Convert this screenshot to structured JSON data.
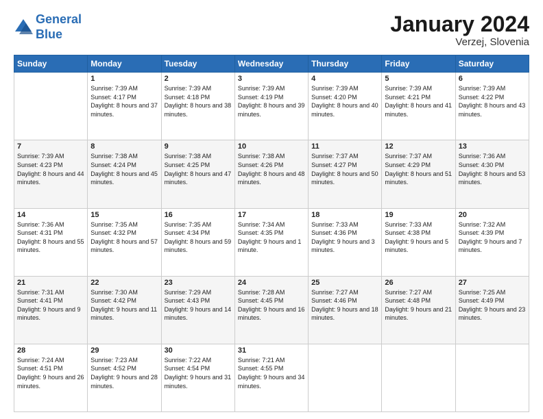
{
  "header": {
    "logo_line1": "General",
    "logo_line2": "Blue",
    "month_year": "January 2024",
    "location": "Verzej, Slovenia"
  },
  "weekdays": [
    "Sunday",
    "Monday",
    "Tuesday",
    "Wednesday",
    "Thursday",
    "Friday",
    "Saturday"
  ],
  "weeks": [
    [
      {
        "day": "",
        "sunrise": "",
        "sunset": "",
        "daylight": ""
      },
      {
        "day": "1",
        "sunrise": "Sunrise: 7:39 AM",
        "sunset": "Sunset: 4:17 PM",
        "daylight": "Daylight: 8 hours and 37 minutes."
      },
      {
        "day": "2",
        "sunrise": "Sunrise: 7:39 AM",
        "sunset": "Sunset: 4:18 PM",
        "daylight": "Daylight: 8 hours and 38 minutes."
      },
      {
        "day": "3",
        "sunrise": "Sunrise: 7:39 AM",
        "sunset": "Sunset: 4:19 PM",
        "daylight": "Daylight: 8 hours and 39 minutes."
      },
      {
        "day": "4",
        "sunrise": "Sunrise: 7:39 AM",
        "sunset": "Sunset: 4:20 PM",
        "daylight": "Daylight: 8 hours and 40 minutes."
      },
      {
        "day": "5",
        "sunrise": "Sunrise: 7:39 AM",
        "sunset": "Sunset: 4:21 PM",
        "daylight": "Daylight: 8 hours and 41 minutes."
      },
      {
        "day": "6",
        "sunrise": "Sunrise: 7:39 AM",
        "sunset": "Sunset: 4:22 PM",
        "daylight": "Daylight: 8 hours and 43 minutes."
      }
    ],
    [
      {
        "day": "7",
        "sunrise": "Sunrise: 7:39 AM",
        "sunset": "Sunset: 4:23 PM",
        "daylight": "Daylight: 8 hours and 44 minutes."
      },
      {
        "day": "8",
        "sunrise": "Sunrise: 7:38 AM",
        "sunset": "Sunset: 4:24 PM",
        "daylight": "Daylight: 8 hours and 45 minutes."
      },
      {
        "day": "9",
        "sunrise": "Sunrise: 7:38 AM",
        "sunset": "Sunset: 4:25 PM",
        "daylight": "Daylight: 8 hours and 47 minutes."
      },
      {
        "day": "10",
        "sunrise": "Sunrise: 7:38 AM",
        "sunset": "Sunset: 4:26 PM",
        "daylight": "Daylight: 8 hours and 48 minutes."
      },
      {
        "day": "11",
        "sunrise": "Sunrise: 7:37 AM",
        "sunset": "Sunset: 4:27 PM",
        "daylight": "Daylight: 8 hours and 50 minutes."
      },
      {
        "day": "12",
        "sunrise": "Sunrise: 7:37 AM",
        "sunset": "Sunset: 4:29 PM",
        "daylight": "Daylight: 8 hours and 51 minutes."
      },
      {
        "day": "13",
        "sunrise": "Sunrise: 7:36 AM",
        "sunset": "Sunset: 4:30 PM",
        "daylight": "Daylight: 8 hours and 53 minutes."
      }
    ],
    [
      {
        "day": "14",
        "sunrise": "Sunrise: 7:36 AM",
        "sunset": "Sunset: 4:31 PM",
        "daylight": "Daylight: 8 hours and 55 minutes."
      },
      {
        "day": "15",
        "sunrise": "Sunrise: 7:35 AM",
        "sunset": "Sunset: 4:32 PM",
        "daylight": "Daylight: 8 hours and 57 minutes."
      },
      {
        "day": "16",
        "sunrise": "Sunrise: 7:35 AM",
        "sunset": "Sunset: 4:34 PM",
        "daylight": "Daylight: 8 hours and 59 minutes."
      },
      {
        "day": "17",
        "sunrise": "Sunrise: 7:34 AM",
        "sunset": "Sunset: 4:35 PM",
        "daylight": "Daylight: 9 hours and 1 minute."
      },
      {
        "day": "18",
        "sunrise": "Sunrise: 7:33 AM",
        "sunset": "Sunset: 4:36 PM",
        "daylight": "Daylight: 9 hours and 3 minutes."
      },
      {
        "day": "19",
        "sunrise": "Sunrise: 7:33 AM",
        "sunset": "Sunset: 4:38 PM",
        "daylight": "Daylight: 9 hours and 5 minutes."
      },
      {
        "day": "20",
        "sunrise": "Sunrise: 7:32 AM",
        "sunset": "Sunset: 4:39 PM",
        "daylight": "Daylight: 9 hours and 7 minutes."
      }
    ],
    [
      {
        "day": "21",
        "sunrise": "Sunrise: 7:31 AM",
        "sunset": "Sunset: 4:41 PM",
        "daylight": "Daylight: 9 hours and 9 minutes."
      },
      {
        "day": "22",
        "sunrise": "Sunrise: 7:30 AM",
        "sunset": "Sunset: 4:42 PM",
        "daylight": "Daylight: 9 hours and 11 minutes."
      },
      {
        "day": "23",
        "sunrise": "Sunrise: 7:29 AM",
        "sunset": "Sunset: 4:43 PM",
        "daylight": "Daylight: 9 hours and 14 minutes."
      },
      {
        "day": "24",
        "sunrise": "Sunrise: 7:28 AM",
        "sunset": "Sunset: 4:45 PM",
        "daylight": "Daylight: 9 hours and 16 minutes."
      },
      {
        "day": "25",
        "sunrise": "Sunrise: 7:27 AM",
        "sunset": "Sunset: 4:46 PM",
        "daylight": "Daylight: 9 hours and 18 minutes."
      },
      {
        "day": "26",
        "sunrise": "Sunrise: 7:27 AM",
        "sunset": "Sunset: 4:48 PM",
        "daylight": "Daylight: 9 hours and 21 minutes."
      },
      {
        "day": "27",
        "sunrise": "Sunrise: 7:25 AM",
        "sunset": "Sunset: 4:49 PM",
        "daylight": "Daylight: 9 hours and 23 minutes."
      }
    ],
    [
      {
        "day": "28",
        "sunrise": "Sunrise: 7:24 AM",
        "sunset": "Sunset: 4:51 PM",
        "daylight": "Daylight: 9 hours and 26 minutes."
      },
      {
        "day": "29",
        "sunrise": "Sunrise: 7:23 AM",
        "sunset": "Sunset: 4:52 PM",
        "daylight": "Daylight: 9 hours and 28 minutes."
      },
      {
        "day": "30",
        "sunrise": "Sunrise: 7:22 AM",
        "sunset": "Sunset: 4:54 PM",
        "daylight": "Daylight: 9 hours and 31 minutes."
      },
      {
        "day": "31",
        "sunrise": "Sunrise: 7:21 AM",
        "sunset": "Sunset: 4:55 PM",
        "daylight": "Daylight: 9 hours and 34 minutes."
      },
      {
        "day": "",
        "sunrise": "",
        "sunset": "",
        "daylight": ""
      },
      {
        "day": "",
        "sunrise": "",
        "sunset": "",
        "daylight": ""
      },
      {
        "day": "",
        "sunrise": "",
        "sunset": "",
        "daylight": ""
      }
    ]
  ]
}
